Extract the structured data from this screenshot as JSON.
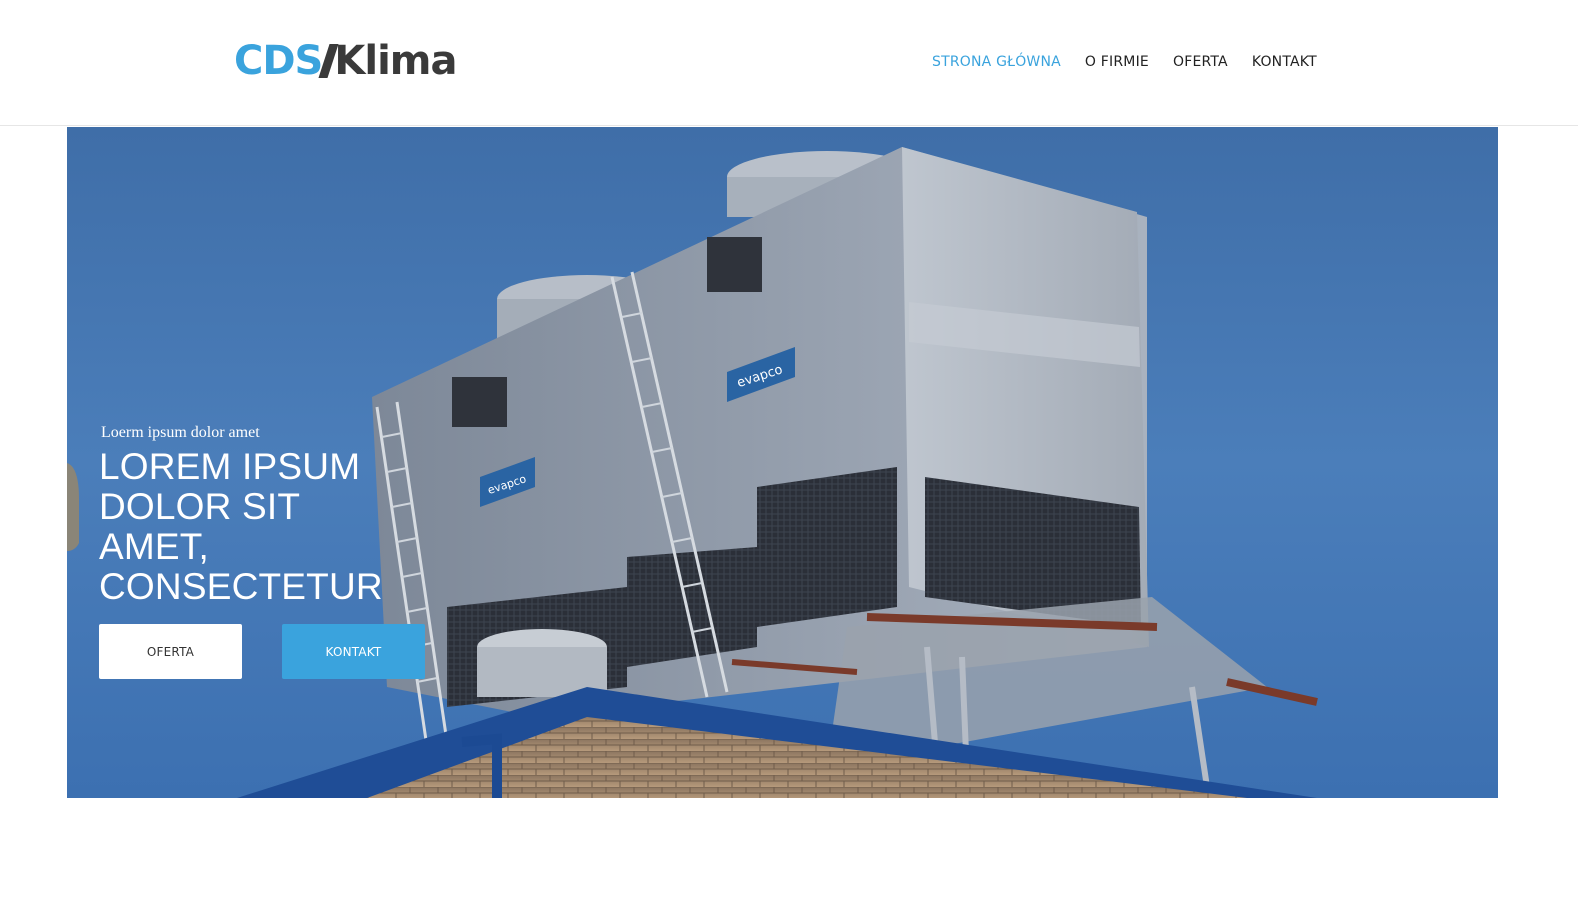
{
  "colors": {
    "brand": "#3aa3dd",
    "dark": "#3a3a3a"
  },
  "logo": {
    "brand": "CDS",
    "name": "Klima"
  },
  "nav": {
    "items": [
      "STRONA GŁÓWNA",
      "O FIRMIE",
      "OFERTA",
      "KONTAKT"
    ],
    "active": "STRONA GŁÓWNA"
  },
  "hero": {
    "eyebrow": "Loerm ipsum dolor amet",
    "headline": "LOREM IPSUM DOLOR SIT AMET, CONSECTETUR",
    "buttons": {
      "primary": "OFERTA",
      "secondary": "KONTAKT"
    },
    "image_text": "evapco"
  }
}
